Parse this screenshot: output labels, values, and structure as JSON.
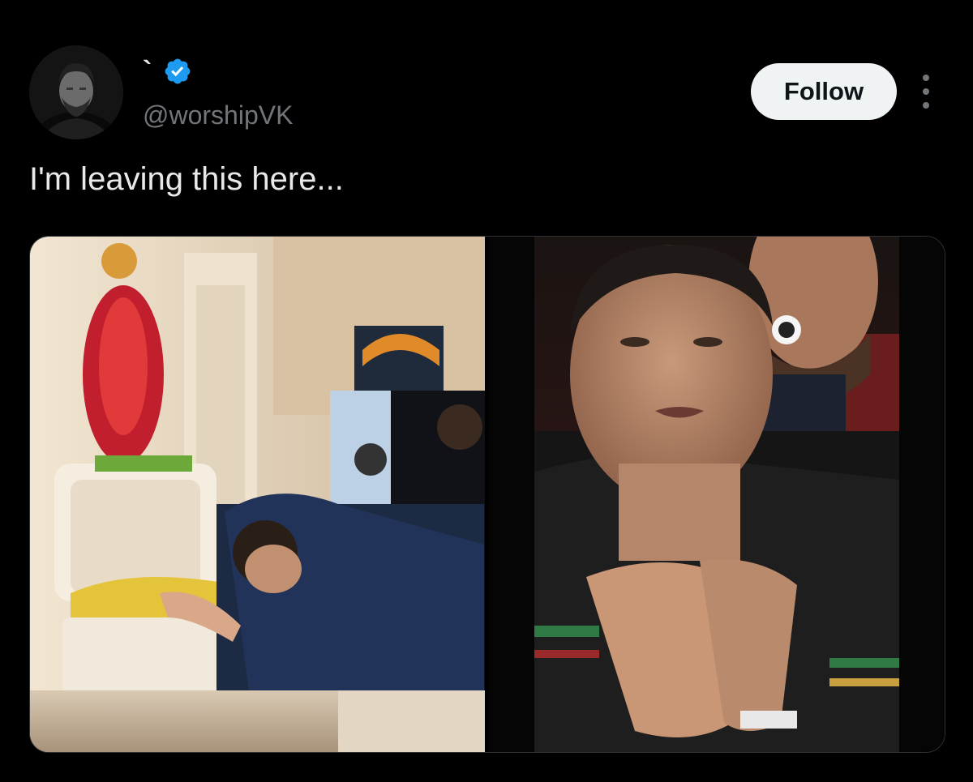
{
  "author": {
    "display_name": "`",
    "handle": "@worshipVK",
    "verified": true,
    "avatar_icon": "profile-avatar"
  },
  "actions": {
    "follow_label": "Follow",
    "more_icon": "more-options-icon"
  },
  "post": {
    "text": "I'm leaving this here..."
  },
  "media": {
    "photos": [
      {
        "icon": "temple-prayer-photo"
      },
      {
        "icon": "praying-footballer-photo"
      }
    ]
  },
  "colors": {
    "background": "#000000",
    "primary_text": "#e7e9ea",
    "secondary_text": "#71767b",
    "verified_blue": "#1d9bf0",
    "follow_bg": "#eff3f4",
    "follow_text": "#0f1419",
    "border": "#2f3336"
  }
}
